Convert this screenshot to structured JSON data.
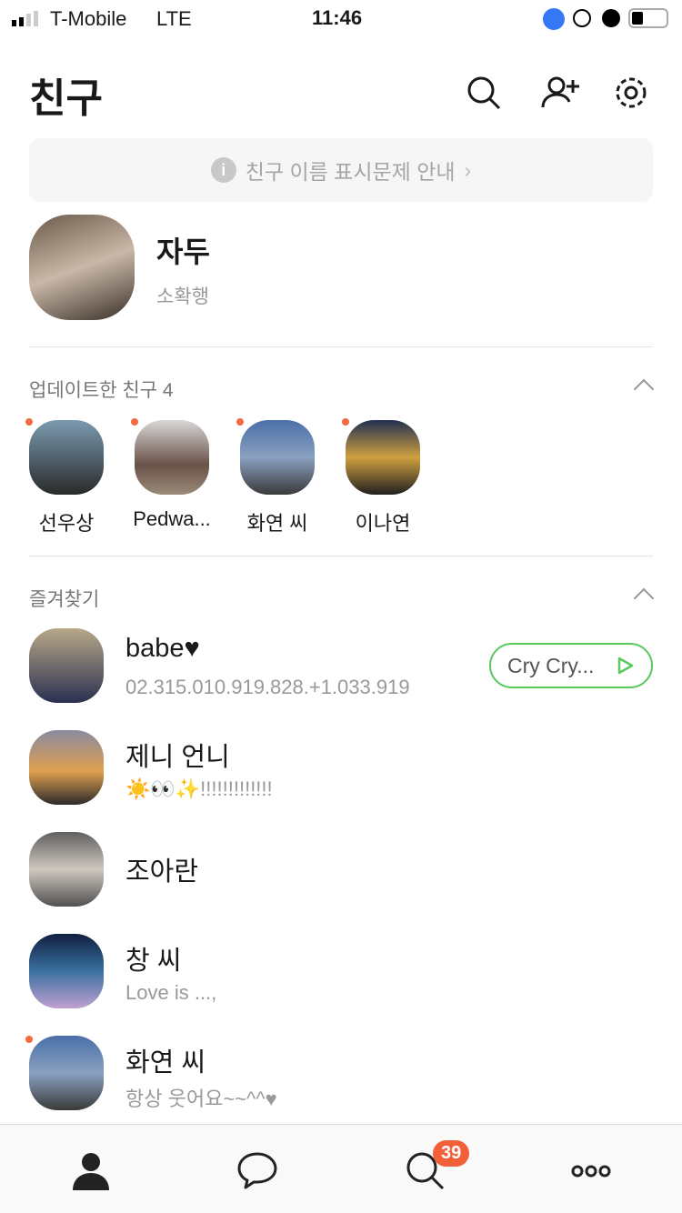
{
  "status": {
    "carrier": "T-Mobile",
    "network": "LTE",
    "time": "11:46"
  },
  "header": {
    "title": "친구"
  },
  "notice": {
    "text": "친구 이름 표시문제 안내"
  },
  "profile": {
    "name": "자두",
    "status": "소확행"
  },
  "updated": {
    "title": "업데이트한 친구 4",
    "friends": [
      {
        "name": "선우상"
      },
      {
        "name": "Pedwa..."
      },
      {
        "name": "화연 씨"
      },
      {
        "name": "이나연"
      }
    ]
  },
  "favorites": {
    "title": "즐겨찾기",
    "items": [
      {
        "name": "babe",
        "heart": "♥",
        "message": "02.315.010.919.828.+1.033.919",
        "music": "Cry Cry..."
      },
      {
        "name": "제니 언니",
        "message": "☀️👀✨!!!!!!!!!!!!!"
      },
      {
        "name": "조아란"
      },
      {
        "name": "창 씨",
        "message": "Love is ...,"
      },
      {
        "name": "화연 씨",
        "message": "항상 웃어요~~^^♥"
      }
    ]
  },
  "tabbar": {
    "badge": "39"
  },
  "colors": {
    "accent_green": "#5ac85a",
    "badge": "#f2603a"
  }
}
